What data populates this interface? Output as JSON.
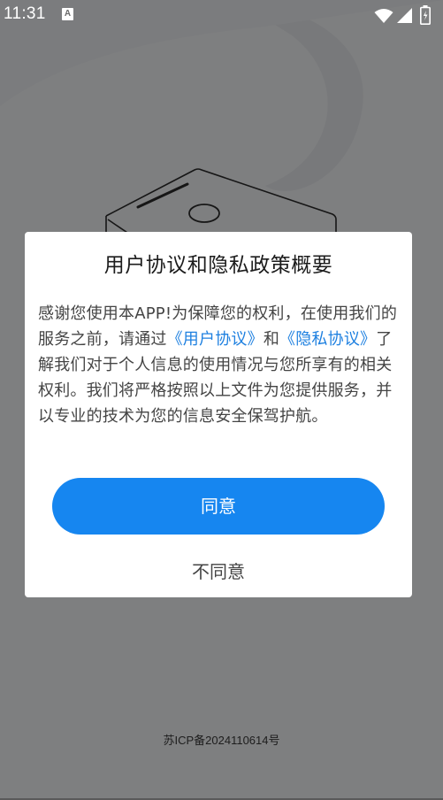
{
  "status_bar": {
    "time": "11:31",
    "notification_icon": "A",
    "icons": [
      "wifi-icon",
      "cellular-signal-icon",
      "battery-icon"
    ]
  },
  "background": {
    "illustration": "device-icon",
    "icp_text": "苏ICP备2024110614号"
  },
  "dialog": {
    "title": "用户协议和隐私政策概要",
    "body": {
      "part1": "感谢您使用本APP!为保障您的权利，在使用我们的服务之前，请通过",
      "link1": "《用户协议》",
      "part2": "和",
      "link2": "《隐私协议》",
      "part3": "了解我们对于个人信息的使用情况与您所享有的相关权利。我们将严格按照以上文件为您提供服务，并以专业的技术为您的信息安全保驾护航。"
    },
    "agree_label": "同意",
    "disagree_label": "不同意"
  },
  "colors": {
    "primary": "#1686f0",
    "link": "#1e80e0"
  }
}
